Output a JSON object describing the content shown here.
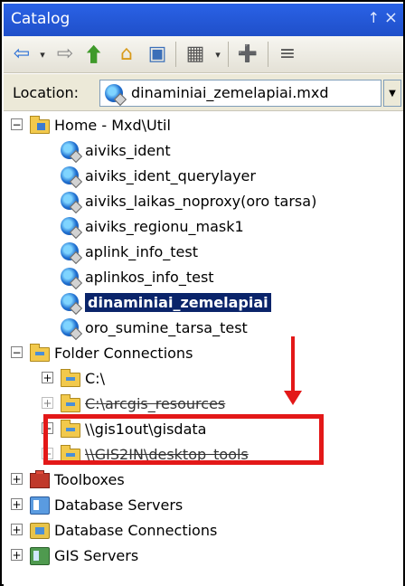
{
  "window": {
    "title": "Catalog",
    "pin_glyph": "↑",
    "close_glyph": "×"
  },
  "toolbar": {
    "back_glyph": "⇦",
    "back_dropdown": "▾",
    "forward_glyph": "⇨",
    "up_glyph": "⮕",
    "home_glyph": "⌂",
    "view_glyph": "▦",
    "view_dropdown": "▾",
    "connect_glyph": "➕",
    "toc_glyph": "≡"
  },
  "location": {
    "label": "Location:",
    "value": "dinaminiai_zemelapiai.mxd",
    "dropdown_glyph": "▼"
  },
  "tree": {
    "home": {
      "expander": "−",
      "label": "Home - Mxd\\Util"
    },
    "home_items": [
      {
        "label": "aiviks_ident"
      },
      {
        "label": "aiviks_ident_querylayer"
      },
      {
        "label": "aiviks_laikas_noproxy(oro tarsa)"
      },
      {
        "label": "aiviks_regionu_mask1"
      },
      {
        "label": "aplink_info_test"
      },
      {
        "label": "aplinkos_info_test"
      },
      {
        "label": "dinaminiai_zemelapiai",
        "selected": true
      },
      {
        "label": "oro_sumine_tarsa_test"
      }
    ],
    "folder_connections": {
      "expander": "−",
      "label": "Folder Connections"
    },
    "connections": [
      {
        "expander": "+",
        "label": "C:\\"
      },
      {
        "expander": "+",
        "label": "C:\\arcgis_resources"
      },
      {
        "expander": "+",
        "label": "\\\\gis1out\\gisdata"
      },
      {
        "expander": "+",
        "label": "\\\\GIS2IN\\desktop_tools"
      }
    ],
    "roots": [
      {
        "expander": "+",
        "label": "Toolboxes"
      },
      {
        "expander": "+",
        "label": "Database Servers"
      },
      {
        "expander": "+",
        "label": "Database Connections"
      },
      {
        "expander": "+",
        "label": "GIS Servers"
      }
    ]
  },
  "colors": {
    "title_bar": "#2a62e6",
    "selection": "#0a246a",
    "annotation": "#e31818"
  }
}
